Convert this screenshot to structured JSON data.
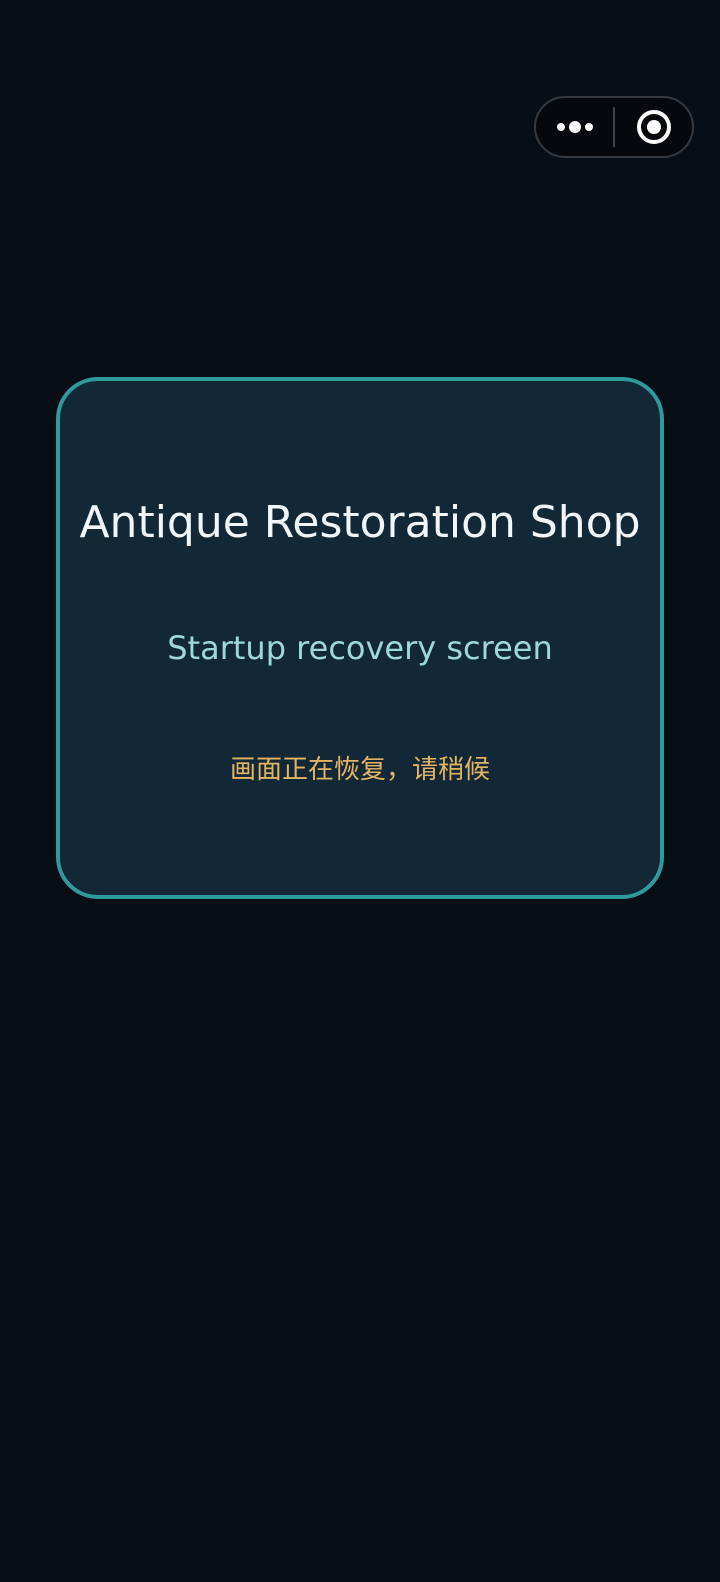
{
  "capsule": {
    "more_icon": "more-dots-icon",
    "close_icon": "target-circle-icon"
  },
  "card": {
    "title": "Antique Restoration Shop",
    "subtitle": "Startup recovery screen",
    "status": "画面正在恢复，请稍候"
  },
  "colors": {
    "background": "#070e16",
    "card_background": "#122836",
    "card_border": "#2f9a9c",
    "title": "#f2f6f8",
    "subtitle": "#9ed7dc",
    "status": "#e5b462"
  }
}
